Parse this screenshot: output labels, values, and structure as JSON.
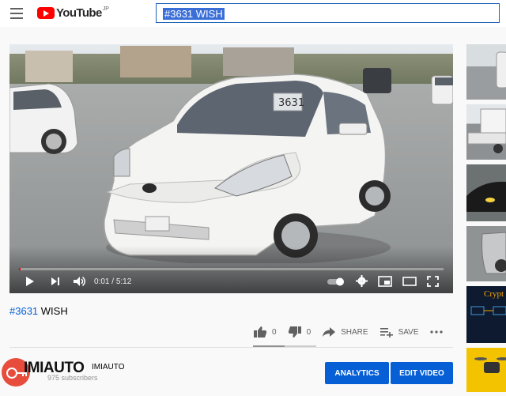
{
  "header": {
    "logo_text": "YouTube",
    "logo_country": "JP",
    "search_value": "#3631 WISH"
  },
  "player": {
    "plate_text": "3631",
    "time_current": "0:01",
    "time_total": "5:12",
    "progress_fraction": 0.003
  },
  "video": {
    "title_hashtag": "#3631",
    "title_rest": " WISH",
    "like_count": "0",
    "dislike_count": "0",
    "share_label": "SHARE",
    "save_label": "SAVE"
  },
  "channel": {
    "name": "IMIAUTO",
    "subscribers": "975 subscribers",
    "watermark_text": "IMIAUTO"
  },
  "buttons": {
    "analytics": "ANALYTICS",
    "edit_video": "EDIT VIDEO"
  },
  "sidebar": {
    "crypto_label": "Crypt"
  }
}
